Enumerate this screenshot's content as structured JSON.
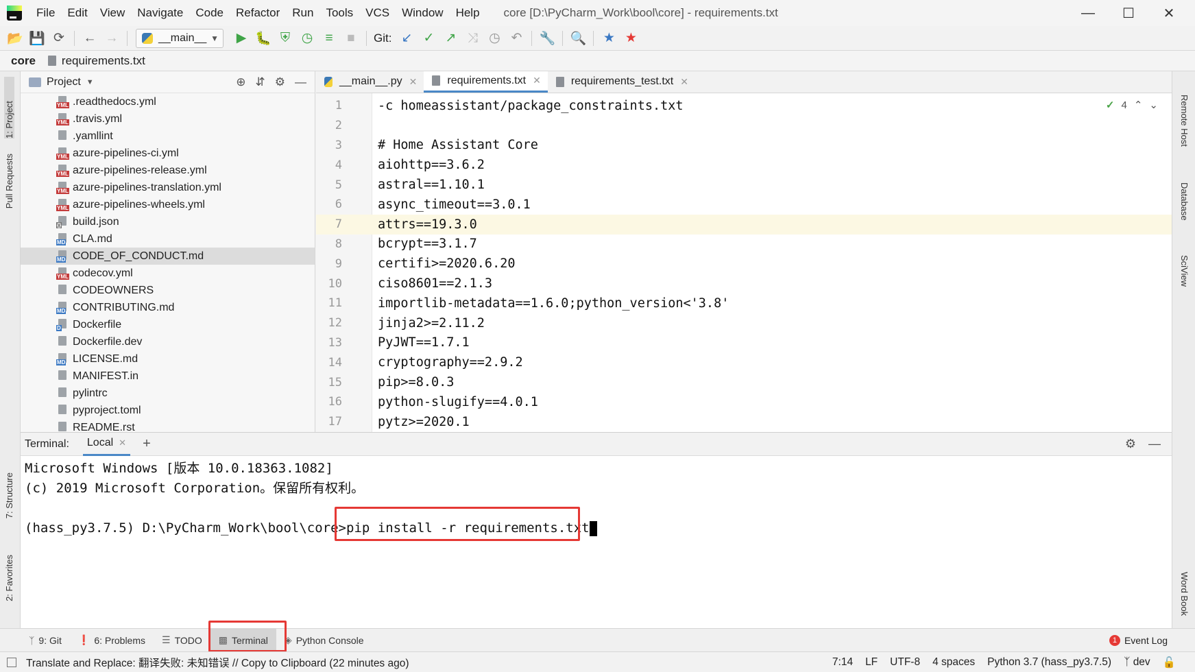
{
  "menu": {
    "items": [
      "File",
      "Edit",
      "View",
      "Navigate",
      "Code",
      "Refactor",
      "Run",
      "Tools",
      "VCS",
      "Window",
      "Help"
    ],
    "title": "core [D:\\PyCharm_Work\\bool\\core] - requirements.txt",
    "min_icon": "minimize-icon",
    "max_icon": "maximize-icon",
    "close_icon": "close-icon"
  },
  "toolbar": {
    "run_config": "__main__",
    "git_label": "Git:"
  },
  "breadcrumb": {
    "root": "core",
    "file": "requirements.txt"
  },
  "left_strip": {
    "project": "1: Project",
    "pull_requests": "Pull Requests",
    "structure": "7: Structure",
    "favorites": "2: Favorites"
  },
  "right_strip": {
    "remote_host": "Remote Host",
    "database": "Database",
    "sciview": "SciView",
    "word_book": "Word Book"
  },
  "project": {
    "header": "Project",
    "items": [
      {
        "name": ".readthedocs.yml",
        "type": "yml"
      },
      {
        "name": ".travis.yml",
        "type": "yml"
      },
      {
        "name": ".yamllint",
        "type": "txt"
      },
      {
        "name": "azure-pipelines-ci.yml",
        "type": "yml"
      },
      {
        "name": "azure-pipelines-release.yml",
        "type": "yml"
      },
      {
        "name": "azure-pipelines-translation.yml",
        "type": "yml"
      },
      {
        "name": "azure-pipelines-wheels.yml",
        "type": "yml"
      },
      {
        "name": "build.json",
        "type": "json"
      },
      {
        "name": "CLA.md",
        "type": "md"
      },
      {
        "name": "CODE_OF_CONDUCT.md",
        "type": "md",
        "selected": true
      },
      {
        "name": "codecov.yml",
        "type": "yml"
      },
      {
        "name": "CODEOWNERS",
        "type": "txt"
      },
      {
        "name": "CONTRIBUTING.md",
        "type": "md"
      },
      {
        "name": "Dockerfile",
        "type": "docker"
      },
      {
        "name": "Dockerfile.dev",
        "type": "txt"
      },
      {
        "name": "LICENSE.md",
        "type": "md"
      },
      {
        "name": "MANIFEST.in",
        "type": "txt"
      },
      {
        "name": "pylintrc",
        "type": "txt"
      },
      {
        "name": "pyproject.toml",
        "type": "txt"
      },
      {
        "name": "README.rst",
        "type": "txt"
      }
    ]
  },
  "editor": {
    "tabs": [
      {
        "label": "__main__.py",
        "icon": "python-file-icon"
      },
      {
        "label": "requirements.txt",
        "icon": "text-file-icon",
        "active": true
      },
      {
        "label": "requirements_test.txt",
        "icon": "text-file-icon"
      }
    ],
    "inspection_count": "4",
    "current_line": 7,
    "lines": [
      {
        "n": "1",
        "text": "-c homeassistant/package_constraints.txt"
      },
      {
        "n": "2",
        "text": ""
      },
      {
        "n": "3",
        "text": "# Home Assistant Core"
      },
      {
        "n": "4",
        "text": "aiohttp==3.6.2"
      },
      {
        "n": "5",
        "text": "astral==1.10.1"
      },
      {
        "n": "6",
        "text": "async_timeout==3.0.1"
      },
      {
        "n": "7",
        "text": "attrs==19.3.0"
      },
      {
        "n": "8",
        "text": "bcrypt==3.1.7"
      },
      {
        "n": "9",
        "text": "certifi>=2020.6.20"
      },
      {
        "n": "10",
        "text": "ciso8601==2.1.3"
      },
      {
        "n": "11",
        "text": "importlib-metadata==1.6.0;python_version<'3.8'"
      },
      {
        "n": "12",
        "text": "jinja2>=2.11.2"
      },
      {
        "n": "13",
        "text": "PyJWT==1.7.1"
      },
      {
        "n": "14",
        "text": "cryptography==2.9.2"
      },
      {
        "n": "15",
        "text": "pip>=8.0.3"
      },
      {
        "n": "16",
        "text": "python-slugify==4.0.1"
      },
      {
        "n": "17",
        "text": "pytz>=2020.1"
      }
    ]
  },
  "terminal": {
    "label": "Terminal:",
    "tab": "Local",
    "lines": [
      "Microsoft Windows [版本 10.0.18363.1082]",
      "(c) 2019 Microsoft Corporation。保留所有权利。",
      ""
    ],
    "prompt": "(hass_py3.7.5) D:\\PyCharm_Work\\bool\\core>",
    "command": "pip install -r requirements.txt"
  },
  "tool_tabs": [
    {
      "label": "9: Git",
      "icon": "git-icon"
    },
    {
      "label": "6: Problems",
      "icon": "problems-icon"
    },
    {
      "label": "TODO",
      "icon": "todo-icon"
    },
    {
      "label": "Terminal",
      "icon": "terminal-icon",
      "active": true
    },
    {
      "label": "Python Console",
      "icon": "python-console-icon"
    }
  ],
  "event_log": {
    "label": "Event Log",
    "count": "1"
  },
  "status": {
    "message": "Translate and Replace: 翻译失败: 未知错误 // Copy to Clipboard (22 minutes ago)",
    "position": "7:14",
    "line_sep": "LF",
    "encoding": "UTF-8",
    "indent": "4 spaces",
    "interpreter": "Python 3.7 (hass_py3.7.5)",
    "branch": "dev"
  },
  "colors": {
    "accent": "#4a88c7",
    "highlight_box": "#e53935",
    "current_line": "#fcf8e3"
  }
}
